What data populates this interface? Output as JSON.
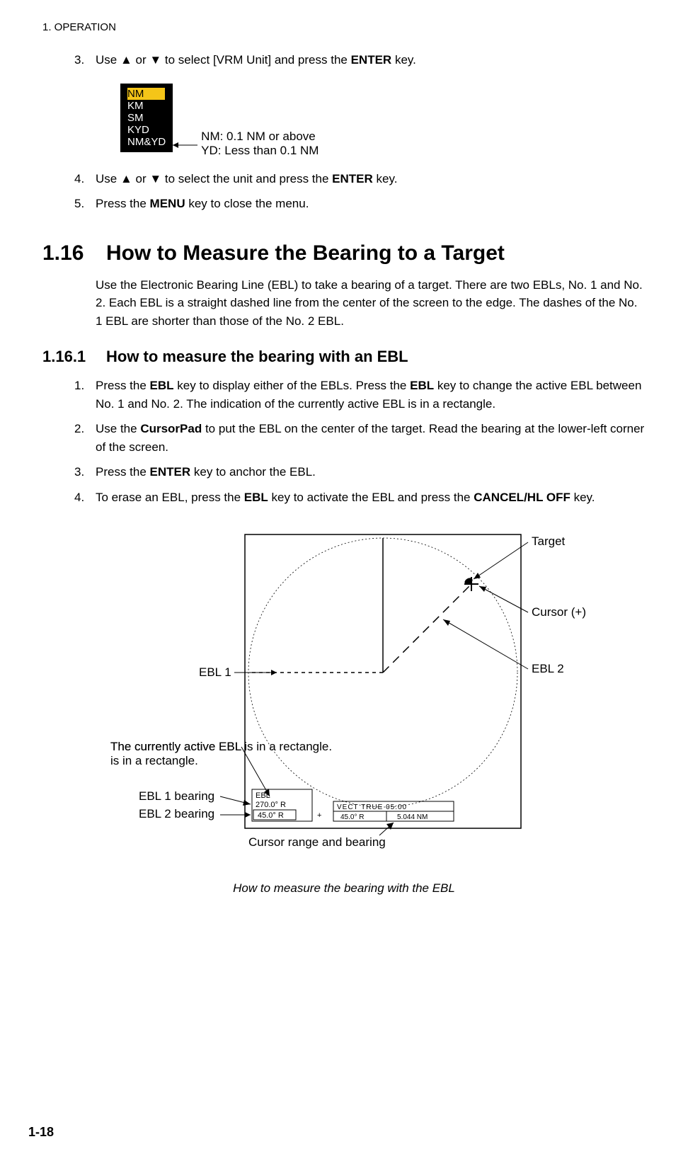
{
  "header": "1.  OPERATION",
  "step3": {
    "num": "3.",
    "text_before": "Use ",
    "text_mid": " or ",
    "text_after": " to select [VRM Unit] and press the ",
    "bold": "ENTER",
    "text_end": " key."
  },
  "menu": {
    "items": [
      "NM",
      "KM",
      "SM",
      "KYD",
      "NM&YD"
    ],
    "selected": "NM",
    "note1": "NM: 0.1 NM or above",
    "note2": "YD: Less than 0.1 NM"
  },
  "step4": {
    "num": "4.",
    "text_before": "Use ",
    "text_mid": " or ",
    "text_after": " to select the unit and press the ",
    "bold": "ENTER",
    "text_end": " key."
  },
  "step5": {
    "num": "5.",
    "text1": "Press the ",
    "bold": "MENU",
    "text2": " key to close the menu."
  },
  "section116": {
    "num": "1.16",
    "title": "How to Measure the Bearing to a Target",
    "para": "Use the Electronic Bearing Line (EBL) to take a bearing of a target. There are two EBLs, No. 1 and No. 2. Each EBL is a straight dashed line from the center of the screen to the edge. The dashes of the No. 1 EBL are shorter than those of the No. 2 EBL."
  },
  "section1161": {
    "num": "1.16.1",
    "title": "How to measure the bearing with an EBL"
  },
  "ebl_step1": {
    "num": "1.",
    "t1": "Press the ",
    "b1": "EBL",
    "t2": " key to display either of the EBLs. Press the ",
    "b2": "EBL",
    "t3": " key to change the active EBL between No. 1 and No. 2. The indication of the currently active EBL is in a rectangle."
  },
  "ebl_step2": {
    "num": "2.",
    "t1": "Use the ",
    "b1": "CursorPad",
    "t2": " to put the EBL on the center of the target. Read the bearing at the lower-left corner of the screen."
  },
  "ebl_step3": {
    "num": "3.",
    "t1": "Press the ",
    "b1": "ENTER",
    "t2": " key to anchor the EBL."
  },
  "ebl_step4": {
    "num": "4.",
    "t1": "To erase an EBL, press the ",
    "b1": "EBL",
    "t2": " key to activate the EBL and press the ",
    "b2": "CANCEL/HL OFF",
    "t3": " key."
  },
  "diagram": {
    "target": "Target",
    "cursor": "Cursor (+)",
    "ebl1": "EBL 1",
    "ebl2": "EBL 2",
    "active_ebl": "The currently active EBL is in a rectangle.",
    "ebl1_bearing": "EBL 1 bearing",
    "ebl2_bearing": "EBL 2 bearing",
    "cursor_range": "Cursor range and bearing",
    "ebl_label": "EBL",
    "val1": "270.0° R",
    "val2": "45.0° R",
    "plus": "+",
    "vect": "VECT  TRUE   05:00",
    "cur_bearing": "45.0° R",
    "cur_range": "5.044 NM"
  },
  "caption": "How to measure the bearing with the EBL",
  "page_num": "1-18"
}
